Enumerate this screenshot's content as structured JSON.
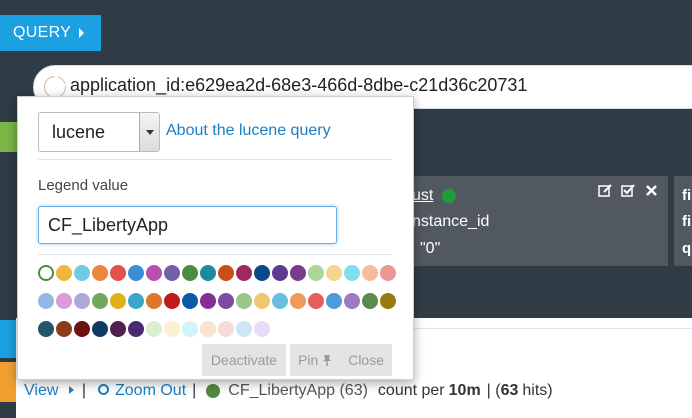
{
  "query_tab": {
    "label": "QUERY"
  },
  "search": {
    "query": "application_id:e629ea2d-68e3-466d-8dbe-c21d36c20731"
  },
  "popup": {
    "query_type": "lucene",
    "about_link": "About the lucene query",
    "legend_label": "Legend value",
    "legend_value": "CF_LibertyApp",
    "colors": [
      [
        "none",
        "#f1b73d",
        "#6ecce0",
        "#ef8441",
        "#e35151",
        "#3a8fd4",
        "#bb4fb0",
        "#7360a8",
        "#4f8a42",
        "#1b8b9b",
        "#c7501a",
        "#a0285e",
        "#0b4a87",
        "#5e3b8e",
        "#7a3b8f",
        "#a8d69c",
        "#f3d58f",
        "#83ddee",
        "#f5bc99",
        "#ee9696"
      ],
      [
        "#90b9e4",
        "#dc9bdb",
        "#b1a6d6",
        "#72a85e",
        "#e2b117",
        "#3ca8c9",
        "#e0762b",
        "#c0191b",
        "#0c5aa6",
        "#862d97",
        "#7e4ba1",
        "#9bc58b",
        "#eec86c",
        "#67c0df",
        "#ef9a5e",
        "#e65f5f",
        "#4d9bd8",
        "#9d78c3",
        "#5a8c4e",
        "#957c10"
      ],
      [
        "#24566a",
        "#8e3d1b",
        "#6e1111",
        "#0f3a66",
        "#53204d",
        "#4a2b72",
        "#d8efd1",
        "#fbf0cf",
        "#d1f3fa",
        "#fbe3d1",
        "#f9dada",
        "#cfe4f6",
        "#e9dbf4"
      ]
    ],
    "deactivate_label": "Deactivate",
    "pin_label": "Pin",
    "close_label": "Close"
  },
  "panel": {
    "field_suffix": "ust",
    "line2": "nstance_id",
    "line3": "\"0\"",
    "right_col": [
      "fi",
      "fi",
      "q"
    ]
  },
  "status": {
    "view_label": "View",
    "zoom_label": "Zoom Out",
    "legend_text": "CF_LibertyApp (63)",
    "count_per": "count per",
    "interval": "10m",
    "hits_open": "| (",
    "hits": "63",
    "hits_close": "hits)"
  }
}
